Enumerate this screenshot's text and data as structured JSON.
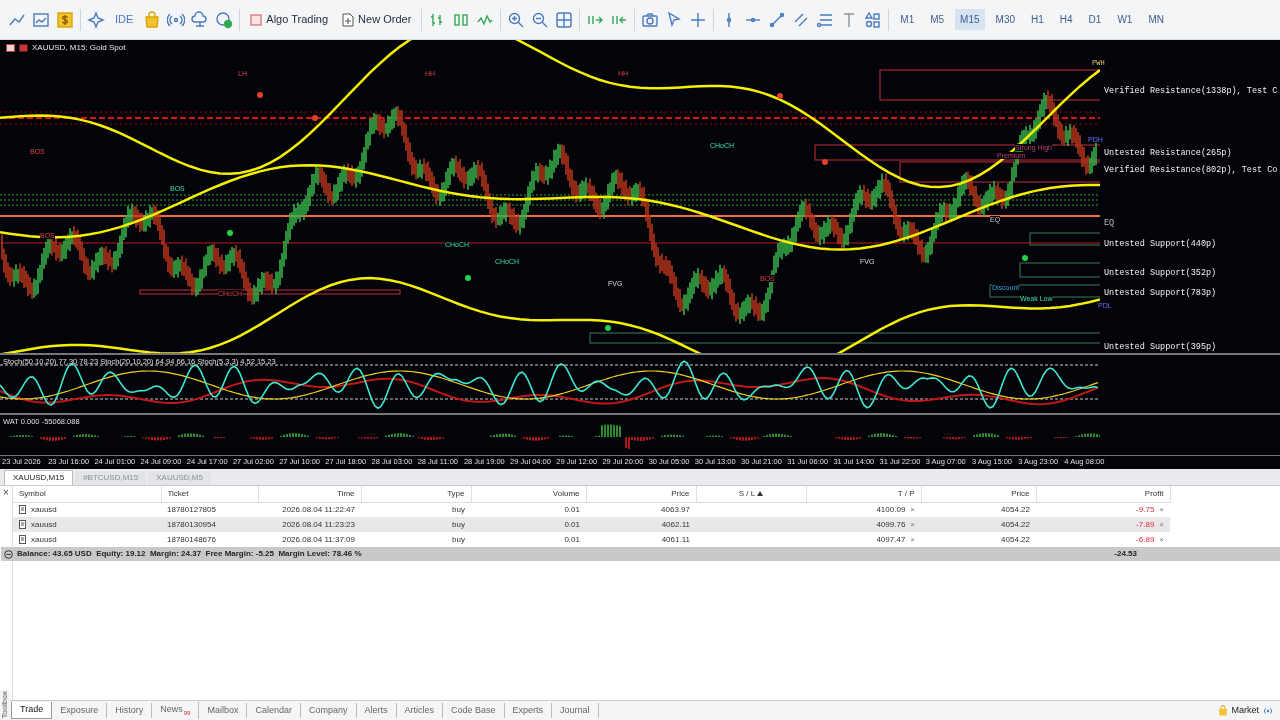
{
  "toolbar": {
    "buttons": [
      {
        "label": "IDE"
      },
      {
        "label": "Algo Trading"
      },
      {
        "label": "New Order"
      }
    ],
    "timeframes": [
      {
        "label": "M1",
        "selected": false
      },
      {
        "label": "M5",
        "selected": false
      },
      {
        "label": "M15",
        "selected": true
      },
      {
        "label": "M30",
        "selected": false
      },
      {
        "label": "H1",
        "selected": false
      },
      {
        "label": "H4",
        "selected": false
      },
      {
        "label": "D1",
        "selected": false
      },
      {
        "label": "W1",
        "selected": false
      },
      {
        "label": "MN",
        "selected": false
      }
    ]
  },
  "chart": {
    "title": "XAUUSD, M15:  Gold Spot",
    "zone_labels": [
      "PWH",
      "Verified Resistance(1338p), Test C",
      "Untested Resistance(265p)",
      "Verified Resistance(802p), Test Co",
      "EQ",
      "Untested Support(440p)",
      "Untested Support(352p)",
      "Untested Support(783p)",
      "Untested Support(395p)"
    ],
    "markers": [
      "LH",
      "BOS",
      "HH",
      "CHoCH",
      "BOS",
      "FVG",
      "CHoCH",
      "BOS",
      "CHoCH",
      "HH",
      "BOS",
      "FVG",
      "CHoCH",
      "Premium",
      "Discount",
      "Weak Low",
      "PDH",
      "PDL",
      "Strong High",
      "EQ"
    ],
    "oscillator_label": "Stoch(50,10,20) 77.30 78.23 Stoch(20,10,20) 64.94 66.16 Stoch(5,3,3) 4.52 15.23",
    "volume_label": "WAT 0.000 -55068.088",
    "time_axis": [
      "23 Jul 2026",
      "23 Jul 16:00",
      "24 Jul 01:00",
      "24 Jul 09:00",
      "24 Jul 17:00",
      "27 Jul 02:00",
      "27 Jul 10:00",
      "27 Jul 18:00",
      "28 Jul 03:00",
      "28 Jul 11:00",
      "28 Jul 19:00",
      "29 Jul 04:00",
      "29 Jul 12:00",
      "29 Jul 20:00",
      "30 Jul 05:00",
      "30 Jul 13:00",
      "30 Jul 21:00",
      "31 Jul 06:00",
      "31 Jul 14:00",
      "31 Jul 22:00",
      "3 Aug 07:00",
      "3 Aug 15:00",
      "3 Aug 23:00",
      "4 Aug 08:00"
    ]
  },
  "chart_tabs": [
    {
      "label": "XAUUSD,M15",
      "selected": true
    },
    {
      "label": "#BTCUSD,M15",
      "selected": false
    },
    {
      "label": "XAUUSD,M5",
      "selected": false
    }
  ],
  "trade_table": {
    "close_mark": "×",
    "columns": [
      "Symbol",
      "Ticket",
      "Time",
      "Type",
      "Volume",
      "Price",
      "S / L",
      "T / P",
      "Price",
      "Profit"
    ],
    "rows": [
      {
        "symbol": "xauusd",
        "ticket": "18780127805",
        "time": "2026.08.04 11:22:47",
        "type": "buy",
        "volume": "0.01",
        "price": "4063.97",
        "tp": "4100.09",
        "tp_close": "×",
        "current_price": "4054.22",
        "profit": "-9.75",
        "profit_close": "×",
        "selected": false
      },
      {
        "symbol": "xauusd",
        "ticket": "18780130954",
        "time": "2026.08.04 11:23:23",
        "type": "buy",
        "volume": "0.01",
        "price": "4062.11",
        "tp": "4099.76",
        "tp_close": "×",
        "current_price": "4054.22",
        "profit": "-7.89",
        "profit_close": "×",
        "selected": true
      },
      {
        "symbol": "xauusd",
        "ticket": "18780148676",
        "time": "2026.08.04 11:37:09",
        "type": "buy",
        "volume": "0.01",
        "price": "4061.11",
        "tp": "4097.47",
        "tp_close": "×",
        "current_price": "4054.22",
        "profit": "-6.89",
        "profit_close": "×",
        "selected": false
      }
    ],
    "summary": {
      "text": "Balance: 43.65 USD  Equity: 19.12  Margin: 24.37  Free Margin: -5.25  Margin Level: 78.46 %",
      "profit": "-24.53"
    }
  },
  "toolbox": {
    "side_label": "Toolbox",
    "tabs": [
      {
        "label": "Trade",
        "selected": true
      },
      {
        "label": "Exposure",
        "selected": false
      },
      {
        "label": "History",
        "selected": false
      },
      {
        "label": "News",
        "badge": "99",
        "selected": false
      },
      {
        "label": "Mailbox",
        "selected": false
      },
      {
        "label": "Calendar",
        "selected": false
      },
      {
        "label": "Company",
        "selected": false
      },
      {
        "label": "Alerts",
        "selected": false
      },
      {
        "label": "Articles",
        "selected": false
      },
      {
        "label": "Code Base",
        "selected": false
      },
      {
        "label": "Experts",
        "selected": false
      },
      {
        "label": "Journal",
        "selected": false
      }
    ],
    "market_label": "Market"
  }
}
